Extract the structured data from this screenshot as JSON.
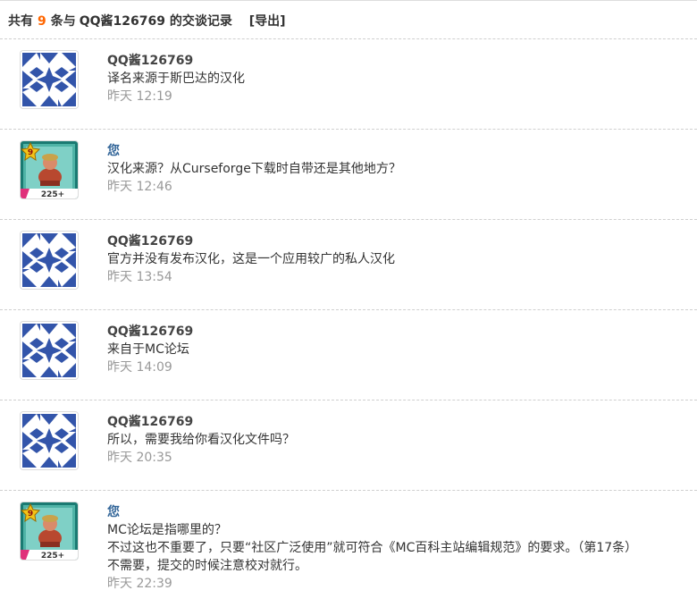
{
  "header": {
    "prefix": "共有",
    "count": "9",
    "middle": "条与",
    "partner": "QQ酱126769",
    "suffix": "的交谈记录",
    "export_label": "[导出]"
  },
  "messages": [
    {
      "author": "QQ酱126769",
      "avatar": "identicon",
      "lines": [
        "译名来源于斯巴达的汉化"
      ],
      "time": "昨天 12:19"
    },
    {
      "author": "您",
      "avatar": "game-card",
      "lines": [
        "汉化来源？从Curseforge下载时自带还是其他地方？"
      ],
      "time": "昨天 12:46"
    },
    {
      "author": "QQ酱126769",
      "avatar": "identicon",
      "lines": [
        "官方并没有发布汉化，这是一个应用较广的私人汉化"
      ],
      "time": "昨天 13:54"
    },
    {
      "author": "QQ酱126769",
      "avatar": "identicon",
      "lines": [
        "来自于MC论坛"
      ],
      "time": "昨天 14:09"
    },
    {
      "author": "QQ酱126769",
      "avatar": "identicon",
      "lines": [
        "所以，需要我给你看汉化文件吗？"
      ],
      "time": "昨天 20:35"
    },
    {
      "author": "您",
      "avatar": "game-card",
      "lines": [
        "MC论坛是指哪里的？",
        "不过这也不重要了，只要“社区广泛使用”就可符合《MC百科主站编辑规范》的要求。（第17条）",
        "不需要，提交的时候注意校对就行。"
      ],
      "time": "昨天 22:39"
    }
  ],
  "colors": {
    "accent_count": "#ff6600",
    "self_name": "#336699",
    "identicon_blue": "#3355aa",
    "timestamp": "#999999"
  },
  "card_badge": {
    "level": "9",
    "number": "225+"
  }
}
